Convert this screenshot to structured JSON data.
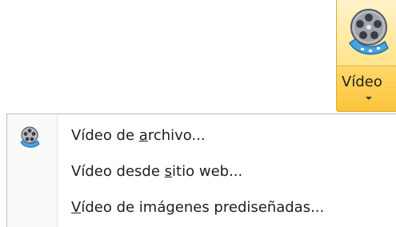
{
  "ribbon": {
    "video_button": {
      "label": "Vídeo",
      "icon": "film-reel-icon"
    }
  },
  "menu": {
    "items": [
      {
        "pre": "Vídeo de ",
        "key": "a",
        "post": "rchivo...",
        "icon": "film-reel-icon"
      },
      {
        "pre": "Vídeo desde ",
        "key": "s",
        "post": "itio web...",
        "icon": null
      },
      {
        "pre": "",
        "key": "V",
        "post": "ídeo de imágenes prediseñadas...",
        "icon": null
      }
    ]
  },
  "colors": {
    "button_highlight": "#fbc53a",
    "button_border": "#e0a93a",
    "menu_border": "#bfbfbf"
  }
}
